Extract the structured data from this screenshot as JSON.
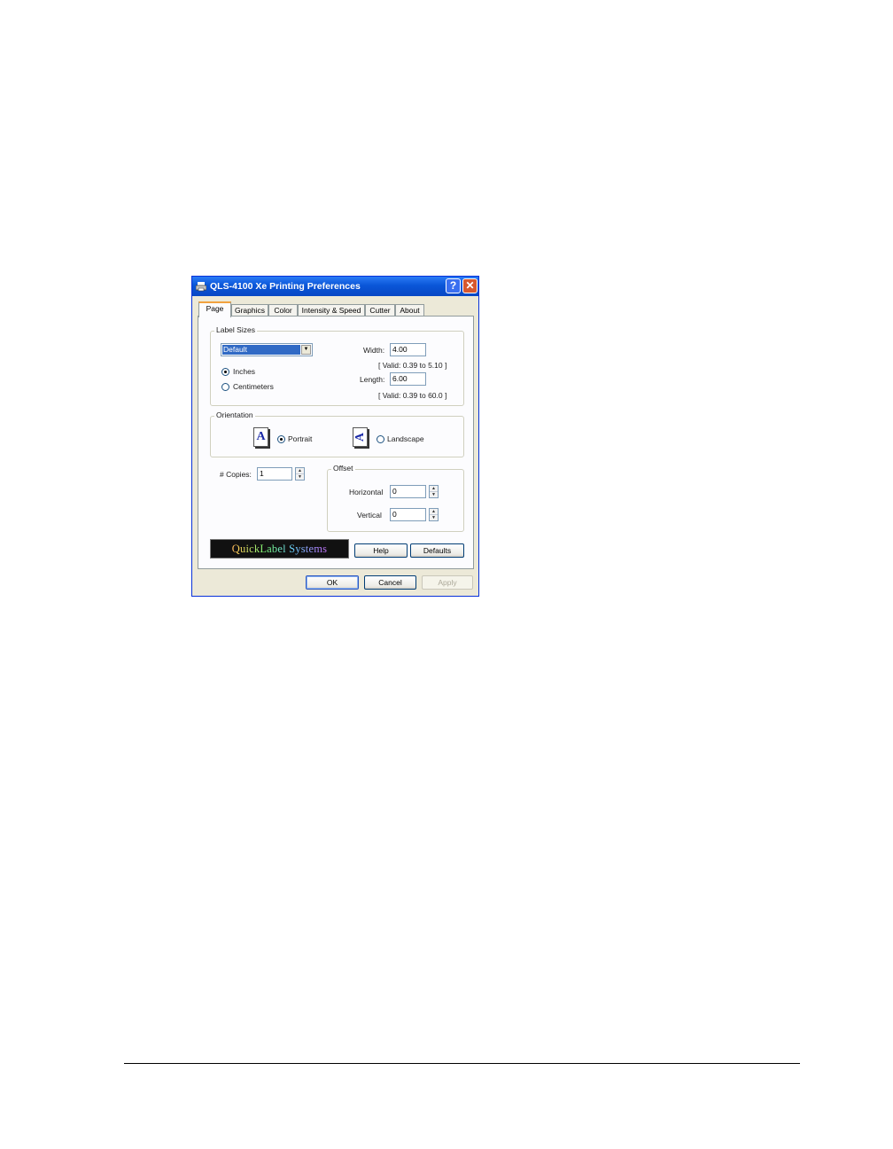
{
  "window": {
    "title": "QLS-4100 Xe Printing Preferences",
    "help_glyph": "?",
    "close_glyph": "✕"
  },
  "tabs": [
    {
      "label": "Page"
    },
    {
      "label": "Graphics"
    },
    {
      "label": "Color"
    },
    {
      "label": "Intensity & Speed"
    },
    {
      "label": "Cutter"
    },
    {
      "label": "About"
    }
  ],
  "label_sizes": {
    "legend": "Label Sizes",
    "selected": "Default",
    "dropdown_glyph": "▼",
    "units": [
      {
        "label": "Inches",
        "selected": true
      },
      {
        "label": "Centimeters",
        "selected": false
      }
    ],
    "width_label": "Width:",
    "width_value": "4.00",
    "width_valid": "[ Valid: 0.39 to 5.10 ]",
    "length_label": "Length:",
    "length_value": "6.00",
    "length_valid": "[ Valid: 0.39 to 60.0 ]"
  },
  "orientation": {
    "legend": "Orientation",
    "portrait_label": "Portrait",
    "portrait_glyph": "A",
    "landscape_label": "Landscape",
    "landscape_glyph": "A",
    "selected": "Portrait"
  },
  "copies": {
    "label": "# Copies:",
    "value": "1"
  },
  "offset": {
    "legend": "Offset",
    "horizontal_label": "Horizontal",
    "horizontal_value": "0",
    "vertical_label": "Vertical",
    "vertical_value": "0"
  },
  "spin_glyphs": {
    "up": "▲",
    "down": "▼"
  },
  "logo": {
    "text": "QuickLabel Systems"
  },
  "buttons": {
    "help": "Help",
    "defaults": "Defaults",
    "ok": "OK",
    "cancel": "Cancel",
    "apply": "Apply"
  },
  "colors": {
    "titlebar": "#0a56d8",
    "dialog_bg": "#ece9d8",
    "tab_highlight": "#f1a23f",
    "close_button": "#d7582f"
  }
}
